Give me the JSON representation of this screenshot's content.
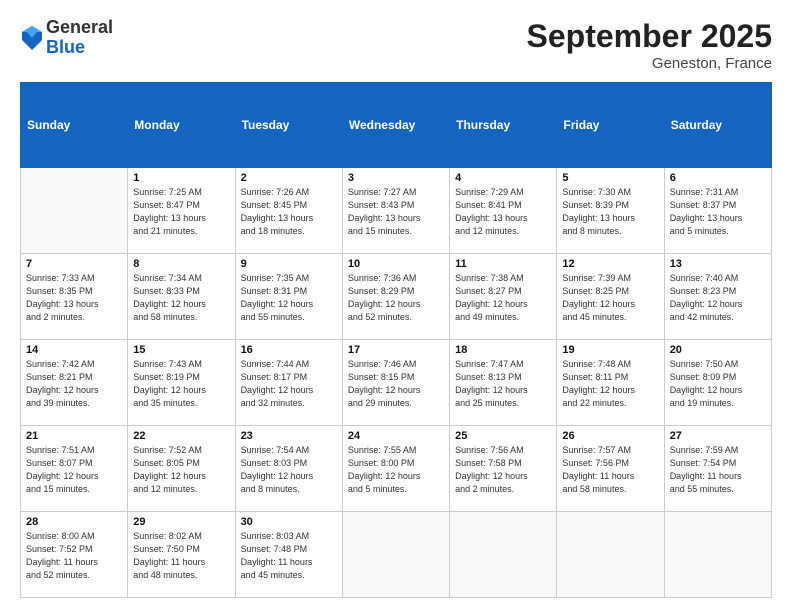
{
  "logo": {
    "general": "General",
    "blue": "Blue"
  },
  "header": {
    "month": "September 2025",
    "location": "Geneston, France"
  },
  "weekdays": [
    "Sunday",
    "Monday",
    "Tuesday",
    "Wednesday",
    "Thursday",
    "Friday",
    "Saturday"
  ],
  "weeks": [
    [
      {
        "day": "",
        "info": ""
      },
      {
        "day": "1",
        "info": "Sunrise: 7:25 AM\nSunset: 8:47 PM\nDaylight: 13 hours\nand 21 minutes."
      },
      {
        "day": "2",
        "info": "Sunrise: 7:26 AM\nSunset: 8:45 PM\nDaylight: 13 hours\nand 18 minutes."
      },
      {
        "day": "3",
        "info": "Sunrise: 7:27 AM\nSunset: 8:43 PM\nDaylight: 13 hours\nand 15 minutes."
      },
      {
        "day": "4",
        "info": "Sunrise: 7:29 AM\nSunset: 8:41 PM\nDaylight: 13 hours\nand 12 minutes."
      },
      {
        "day": "5",
        "info": "Sunrise: 7:30 AM\nSunset: 8:39 PM\nDaylight: 13 hours\nand 8 minutes."
      },
      {
        "day": "6",
        "info": "Sunrise: 7:31 AM\nSunset: 8:37 PM\nDaylight: 13 hours\nand 5 minutes."
      }
    ],
    [
      {
        "day": "7",
        "info": "Sunrise: 7:33 AM\nSunset: 8:35 PM\nDaylight: 13 hours\nand 2 minutes."
      },
      {
        "day": "8",
        "info": "Sunrise: 7:34 AM\nSunset: 8:33 PM\nDaylight: 12 hours\nand 58 minutes."
      },
      {
        "day": "9",
        "info": "Sunrise: 7:35 AM\nSunset: 8:31 PM\nDaylight: 12 hours\nand 55 minutes."
      },
      {
        "day": "10",
        "info": "Sunrise: 7:36 AM\nSunset: 8:29 PM\nDaylight: 12 hours\nand 52 minutes."
      },
      {
        "day": "11",
        "info": "Sunrise: 7:38 AM\nSunset: 8:27 PM\nDaylight: 12 hours\nand 49 minutes."
      },
      {
        "day": "12",
        "info": "Sunrise: 7:39 AM\nSunset: 8:25 PM\nDaylight: 12 hours\nand 45 minutes."
      },
      {
        "day": "13",
        "info": "Sunrise: 7:40 AM\nSunset: 8:23 PM\nDaylight: 12 hours\nand 42 minutes."
      }
    ],
    [
      {
        "day": "14",
        "info": "Sunrise: 7:42 AM\nSunset: 8:21 PM\nDaylight: 12 hours\nand 39 minutes."
      },
      {
        "day": "15",
        "info": "Sunrise: 7:43 AM\nSunset: 8:19 PM\nDaylight: 12 hours\nand 35 minutes."
      },
      {
        "day": "16",
        "info": "Sunrise: 7:44 AM\nSunset: 8:17 PM\nDaylight: 12 hours\nand 32 minutes."
      },
      {
        "day": "17",
        "info": "Sunrise: 7:46 AM\nSunset: 8:15 PM\nDaylight: 12 hours\nand 29 minutes."
      },
      {
        "day": "18",
        "info": "Sunrise: 7:47 AM\nSunset: 8:13 PM\nDaylight: 12 hours\nand 25 minutes."
      },
      {
        "day": "19",
        "info": "Sunrise: 7:48 AM\nSunset: 8:11 PM\nDaylight: 12 hours\nand 22 minutes."
      },
      {
        "day": "20",
        "info": "Sunrise: 7:50 AM\nSunset: 8:09 PM\nDaylight: 12 hours\nand 19 minutes."
      }
    ],
    [
      {
        "day": "21",
        "info": "Sunrise: 7:51 AM\nSunset: 8:07 PM\nDaylight: 12 hours\nand 15 minutes."
      },
      {
        "day": "22",
        "info": "Sunrise: 7:52 AM\nSunset: 8:05 PM\nDaylight: 12 hours\nand 12 minutes."
      },
      {
        "day": "23",
        "info": "Sunrise: 7:54 AM\nSunset: 8:03 PM\nDaylight: 12 hours\nand 8 minutes."
      },
      {
        "day": "24",
        "info": "Sunrise: 7:55 AM\nSunset: 8:00 PM\nDaylight: 12 hours\nand 5 minutes."
      },
      {
        "day": "25",
        "info": "Sunrise: 7:56 AM\nSunset: 7:58 PM\nDaylight: 12 hours\nand 2 minutes."
      },
      {
        "day": "26",
        "info": "Sunrise: 7:57 AM\nSunset: 7:56 PM\nDaylight: 11 hours\nand 58 minutes."
      },
      {
        "day": "27",
        "info": "Sunrise: 7:59 AM\nSunset: 7:54 PM\nDaylight: 11 hours\nand 55 minutes."
      }
    ],
    [
      {
        "day": "28",
        "info": "Sunrise: 8:00 AM\nSunset: 7:52 PM\nDaylight: 11 hours\nand 52 minutes."
      },
      {
        "day": "29",
        "info": "Sunrise: 8:02 AM\nSunset: 7:50 PM\nDaylight: 11 hours\nand 48 minutes."
      },
      {
        "day": "30",
        "info": "Sunrise: 8:03 AM\nSunset: 7:48 PM\nDaylight: 11 hours\nand 45 minutes."
      },
      {
        "day": "",
        "info": ""
      },
      {
        "day": "",
        "info": ""
      },
      {
        "day": "",
        "info": ""
      },
      {
        "day": "",
        "info": ""
      }
    ]
  ]
}
